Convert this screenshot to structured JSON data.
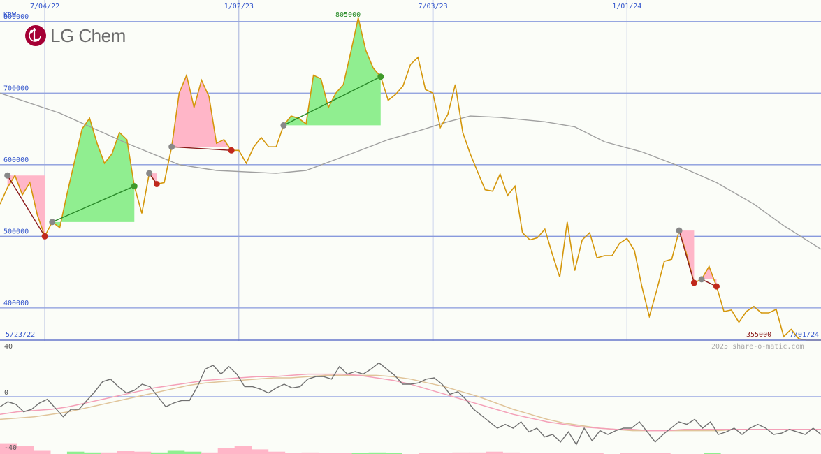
{
  "logo": {
    "text": "LG Chem",
    "mark_color": "#a50034"
  },
  "currency_label": "KRW",
  "watermark": "2025 share-o-matic.com",
  "colors": {
    "price": "#d4960a",
    "ma_gray": "#a0a0a0",
    "grid_major": "#8899dd",
    "grid_vertical": "#8899dd",
    "up_fill": "#90ee90",
    "down_fill": "#ffb6c8",
    "up_line": "#2a8a2a",
    "down_line": "#8b1a1a",
    "label_blue": "#3355cc",
    "label_green": "#228822",
    "label_darkred": "#8b1a1a",
    "osc_black": "#707070",
    "osc_pink": "#f4a0b8",
    "osc_tan": "#e0c49a"
  },
  "annotations": {
    "start_date": "5/23/22",
    "end_date": "7/01/24",
    "high_label": "805000",
    "low_label": "355000"
  },
  "chart_data": [
    {
      "type": "line",
      "title": "",
      "x_axis": {
        "type": "date",
        "range": [
          "2022-05-23",
          "2024-07-01"
        ],
        "ticks": [
          "7/04/22",
          "1/02/23",
          "7/03/23",
          "1/01/24"
        ]
      },
      "y_axis": {
        "range": [
          355000,
          830000
        ],
        "ticks": [
          400000,
          500000,
          600000,
          700000,
          800000
        ],
        "tick_labels": [
          "400000",
          "500000",
          "600000",
          "700000",
          "800000"
        ]
      },
      "grid": true,
      "series": [
        {
          "role": "price",
          "points": [
            [
              "2022-05-23",
              545000
            ],
            [
              "2022-05-30",
              568000
            ],
            [
              "2022-06-06",
              585000
            ],
            [
              "2022-06-13",
              558000
            ],
            [
              "2022-06-20",
              575000
            ],
            [
              "2022-06-27",
              530000
            ],
            [
              "2022-07-04",
              500000
            ],
            [
              "2022-07-11",
              520000
            ],
            [
              "2022-07-18",
              512000
            ],
            [
              "2022-07-25",
              560000
            ],
            [
              "2022-08-01",
              605000
            ],
            [
              "2022-08-08",
              650000
            ],
            [
              "2022-08-15",
              665000
            ],
            [
              "2022-08-22",
              630000
            ],
            [
              "2022-08-29",
              602000
            ],
            [
              "2022-09-05",
              615000
            ],
            [
              "2022-09-12",
              645000
            ],
            [
              "2022-09-19",
              635000
            ],
            [
              "2022-09-26",
              570000
            ],
            [
              "2022-10-03",
              532000
            ],
            [
              "2022-10-10",
              588000
            ],
            [
              "2022-10-17",
              573000
            ],
            [
              "2022-10-24",
              575000
            ],
            [
              "2022-10-31",
              625000
            ],
            [
              "2022-11-07",
              700000
            ],
            [
              "2022-11-14",
              725000
            ],
            [
              "2022-11-21",
              680000
            ],
            [
              "2022-11-28",
              718000
            ],
            [
              "2022-12-05",
              695000
            ],
            [
              "2022-12-12",
              630000
            ],
            [
              "2022-12-19",
              635000
            ],
            [
              "2022-12-26",
              620000
            ],
            [
              "2023-01-02",
              620000
            ],
            [
              "2023-01-09",
              602000
            ],
            [
              "2023-01-16",
              625000
            ],
            [
              "2023-01-23",
              638000
            ],
            [
              "2023-01-30",
              625000
            ],
            [
              "2023-02-06",
              625000
            ],
            [
              "2023-02-13",
              655000
            ],
            [
              "2023-02-20",
              668000
            ],
            [
              "2023-02-27",
              665000
            ],
            [
              "2023-03-06",
              657000
            ],
            [
              "2023-03-13",
              725000
            ],
            [
              "2023-03-20",
              720000
            ],
            [
              "2023-03-27",
              680000
            ],
            [
              "2023-04-03",
              700000
            ],
            [
              "2023-04-10",
              712000
            ],
            [
              "2023-04-17",
              757000
            ],
            [
              "2023-04-24",
              805000
            ],
            [
              "2023-05-01",
              760000
            ],
            [
              "2023-05-08",
              735000
            ],
            [
              "2023-05-15",
              723000
            ],
            [
              "2023-05-22",
              690000
            ],
            [
              "2023-05-29",
              698000
            ],
            [
              "2023-06-05",
              710000
            ],
            [
              "2023-06-12",
              740000
            ],
            [
              "2023-06-19",
              750000
            ],
            [
              "2023-06-26",
              705000
            ],
            [
              "2023-07-03",
              700000
            ],
            [
              "2023-07-10",
              652000
            ],
            [
              "2023-07-17",
              670000
            ],
            [
              "2023-07-24",
              712000
            ],
            [
              "2023-07-31",
              645000
            ],
            [
              "2023-08-07",
              615000
            ],
            [
              "2023-08-14",
              590000
            ],
            [
              "2023-08-21",
              565000
            ],
            [
              "2023-08-28",
              563000
            ],
            [
              "2023-09-04",
              587000
            ],
            [
              "2023-09-11",
              557000
            ],
            [
              "2023-09-18",
              570000
            ],
            [
              "2023-09-25",
              505000
            ],
            [
              "2023-10-02",
              495000
            ],
            [
              "2023-10-09",
              498000
            ],
            [
              "2023-10-16",
              510000
            ],
            [
              "2023-10-23",
              475000
            ],
            [
              "2023-10-30",
              443000
            ],
            [
              "2023-11-06",
              520000
            ],
            [
              "2023-11-13",
              452000
            ],
            [
              "2023-11-20",
              495000
            ],
            [
              "2023-11-27",
              505000
            ],
            [
              "2023-12-04",
              470000
            ],
            [
              "2023-12-11",
              473000
            ],
            [
              "2023-12-18",
              473000
            ],
            [
              "2023-12-25",
              490000
            ],
            [
              "2024-01-01",
              497000
            ],
            [
              "2024-01-08",
              480000
            ],
            [
              "2024-01-15",
              430000
            ],
            [
              "2024-01-22",
              388000
            ],
            [
              "2024-01-29",
              425000
            ],
            [
              "2024-02-05",
              465000
            ],
            [
              "2024-02-12",
              468000
            ],
            [
              "2024-02-19",
              508000
            ],
            [
              "2024-02-26",
              475000
            ],
            [
              "2024-03-04",
              435000
            ],
            [
              "2024-03-11",
              440000
            ],
            [
              "2024-03-18",
              458000
            ],
            [
              "2024-03-25",
              430000
            ],
            [
              "2024-04-01",
              395000
            ],
            [
              "2024-04-08",
              397000
            ],
            [
              "2024-04-15",
              380000
            ],
            [
              "2024-04-22",
              395000
            ],
            [
              "2024-04-29",
              402000
            ],
            [
              "2024-05-06",
              393000
            ],
            [
              "2024-05-13",
              393000
            ],
            [
              "2024-05-20",
              398000
            ],
            [
              "2024-05-27",
              360000
            ],
            [
              "2024-06-03",
              370000
            ],
            [
              "2024-06-10",
              357000
            ],
            [
              "2024-06-17",
              355000
            ],
            [
              "2024-06-24",
              355000
            ],
            [
              "2024-07-01",
              355000
            ]
          ]
        },
        {
          "role": "moving-average",
          "points": [
            [
              "2022-05-23",
              700000
            ],
            [
              "2022-07-18",
              672000
            ],
            [
              "2022-09-19",
              630000
            ],
            [
              "2022-11-07",
              600000
            ],
            [
              "2022-12-12",
              592000
            ],
            [
              "2023-02-06",
              588000
            ],
            [
              "2023-03-06",
              592000
            ],
            [
              "2023-04-17",
              615000
            ],
            [
              "2023-05-22",
              635000
            ],
            [
              "2023-06-19",
              647000
            ],
            [
              "2023-07-17",
              660000
            ],
            [
              "2023-08-07",
              668000
            ],
            [
              "2023-09-04",
              666000
            ],
            [
              "2023-10-16",
              660000
            ],
            [
              "2023-11-13",
              653000
            ],
            [
              "2023-12-11",
              632000
            ],
            [
              "2024-01-15",
              618000
            ],
            [
              "2024-02-19",
              598000
            ],
            [
              "2024-03-25",
              575000
            ],
            [
              "2024-04-29",
              545000
            ],
            [
              "2024-05-27",
              515000
            ],
            [
              "2024-07-01",
              482000
            ]
          ]
        }
      ],
      "signals": [
        {
          "start": [
            "2022-05-30",
            585000
          ],
          "end": [
            "2022-07-04",
            500000
          ],
          "direction": "down"
        },
        {
          "start": [
            "2022-07-11",
            520000
          ],
          "end": [
            "2022-09-26",
            570000
          ],
          "direction": "up"
        },
        {
          "start": [
            "2022-10-10",
            588000
          ],
          "end": [
            "2022-10-17",
            573000
          ],
          "direction": "down"
        },
        {
          "start": [
            "2022-10-31",
            625000
          ],
          "end": [
            "2022-12-26",
            620000
          ],
          "direction": "down"
        },
        {
          "start": [
            "2023-02-13",
            655000
          ],
          "end": [
            "2023-05-15",
            723000
          ],
          "direction": "up"
        },
        {
          "start": [
            "2024-02-19",
            508000
          ],
          "end": [
            "2024-03-04",
            435000
          ],
          "direction": "down"
        },
        {
          "start": [
            "2024-03-11",
            440000
          ],
          "end": [
            "2024-03-25",
            430000
          ],
          "direction": "down"
        }
      ]
    },
    {
      "type": "line",
      "title": "",
      "y_axis": {
        "range": [
          -40,
          40
        ],
        "ticks": [
          -40,
          0,
          40
        ],
        "tick_labels": [
          "-40",
          "0",
          "40"
        ]
      },
      "grid": true,
      "series": [
        {
          "role": "oscillator",
          "values": [
            -8,
            -4,
            -6,
            -12,
            -10,
            -5,
            -2,
            -9,
            -16,
            -10,
            -10,
            -3,
            4,
            12,
            14,
            8,
            3,
            5,
            10,
            8,
            0,
            -8,
            -5,
            -3,
            -3,
            8,
            22,
            25,
            18,
            24,
            18,
            8,
            8,
            6,
            3,
            7,
            10,
            7,
            8,
            14,
            16,
            16,
            14,
            24,
            18,
            20,
            18,
            22,
            27,
            22,
            17,
            10,
            10,
            11,
            14,
            15,
            10,
            2,
            4,
            -2,
            -10,
            -15,
            -20,
            -25,
            -22,
            -25,
            -20,
            -28,
            -25,
            -32,
            -30,
            -36,
            -28,
            -38,
            -25,
            -35,
            -27,
            -30,
            -27,
            -25,
            -25,
            -20,
            -28,
            -36,
            -30,
            -25,
            -20,
            -22,
            -18,
            -25,
            -20,
            -30,
            -28,
            -25,
            -30,
            -25,
            -22,
            -25,
            -30,
            -29,
            -26,
            -28,
            -30,
            -25,
            -30
          ]
        },
        {
          "role": "signal-1",
          "values": [
            -14,
            -12,
            -11,
            -10,
            -8,
            -5,
            -2,
            1,
            4,
            7,
            9,
            11,
            13,
            14,
            15,
            16,
            16,
            17,
            18,
            18,
            18,
            17,
            15,
            13,
            10,
            6,
            2,
            -2,
            -6,
            -10,
            -14,
            -17,
            -20,
            -22,
            -24,
            -25,
            -26,
            -26,
            -27,
            -27,
            -26,
            -26,
            -26,
            -26,
            -26,
            -26,
            -26,
            -26,
            -26
          ]
        },
        {
          "role": "signal-2",
          "values": [
            -18,
            -17,
            -16,
            -14,
            -12,
            -9,
            -6,
            -3,
            0,
            3,
            6,
            9,
            11,
            12,
            13,
            14,
            15,
            15,
            16,
            17,
            17,
            17,
            17,
            16,
            14,
            11,
            8,
            4,
            0,
            -5,
            -10,
            -14,
            -18,
            -21,
            -23,
            -25,
            -26,
            -27,
            -27,
            -27,
            -27,
            -27,
            -27,
            -26,
            -26,
            -26,
            -26,
            -26,
            -26
          ]
        },
        {
          "role": "histogram",
          "values": [
            -14,
            -10,
            -5,
            0,
            3,
            2,
            -2,
            -4,
            -3,
            2,
            5,
            3,
            -2,
            -8,
            -10,
            -6,
            -3,
            -1,
            -2,
            -1,
            -1,
            1,
            2,
            1,
            0,
            -1,
            -1,
            -2,
            -2,
            -3,
            -2,
            -1,
            -1,
            -1,
            -1,
            -1,
            0,
            -1,
            -1,
            -1,
            0,
            0,
            1,
            0,
            0,
            0,
            0,
            0,
            0
          ]
        }
      ]
    }
  ]
}
